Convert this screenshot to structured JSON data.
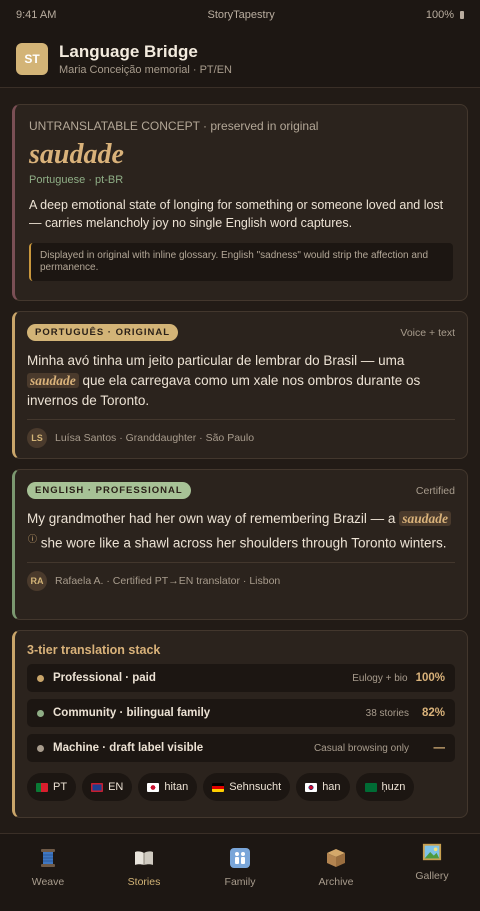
{
  "status": {
    "time": "9:41 AM",
    "app": "StoryTapestry",
    "battery": "100%"
  },
  "header": {
    "avatar": "ST",
    "title": "Language Bridge",
    "subtitle": "Maria Conceição memorial · PT/EN"
  },
  "concept": {
    "kicker": "UNTRANSLATABLE CONCEPT · preserved in original",
    "word": "saudade",
    "language": "Portuguese · pt-BR",
    "description": "A deep emotional state of longing for something or someone loved and lost — carries melancholy joy no single English word captures.",
    "note": "Displayed in original with inline glossary. English \"sadness\" would strip the affection and permanence."
  },
  "original": {
    "pill": "PORTUGUÊS · ORIGINAL",
    "meta": "Voice + text",
    "text_before": "Minha avó tinha um jeito particular de lembrar do Brasil — uma",
    "word": "saudade",
    "text_after": "que ela carregava como um xale nos ombros durante os invernos de Toronto.",
    "initials": "LS",
    "attribution": "Luísa Santos · Granddaughter · São Paulo"
  },
  "english": {
    "pill": "ENGLISH · PROFESSIONAL",
    "meta": "Certified",
    "text_before": "My grandmother had her own way of remembering Brazil — a",
    "word": "saudade",
    "info": "ⓘ",
    "text_after": "she wore like a shawl across her shoulders through Toronto winters.",
    "initials": "RA",
    "attribution": "Rafaela A. · Certified PT→EN translator · Lisbon"
  },
  "stack": {
    "title": "3-tier translation stack",
    "tiers": [
      {
        "name": "Professional · paid",
        "note": "Eulogy + bio",
        "value": "100%",
        "color": "#c9a56a"
      },
      {
        "name": "Community · bilingual family",
        "note": "38 stories",
        "value": "82%",
        "color": "#8fae86"
      },
      {
        "name": "Machine · draft label visible",
        "note": "Casual browsing only",
        "value": "—",
        "color": "#a89c8d"
      }
    ],
    "chips": [
      {
        "label": "PT",
        "icon": "flag-portugal-icon"
      },
      {
        "label": "EN",
        "icon": "flag-uk-icon"
      },
      {
        "label": "hitan",
        "icon": "flag-japan-icon"
      },
      {
        "label": "Sehnsucht",
        "icon": "flag-germany-icon"
      },
      {
        "label": "han",
        "icon": "flag-korea-icon"
      },
      {
        "label": "ḥuzn",
        "icon": "flag-saudi-icon"
      }
    ]
  },
  "tabs": [
    {
      "label": "Weave",
      "icon": "spool-icon"
    },
    {
      "label": "Stories",
      "icon": "book-icon",
      "active": true
    },
    {
      "label": "Family",
      "icon": "family-icon"
    },
    {
      "label": "Archive",
      "icon": "box-icon"
    },
    {
      "label": "Gallery",
      "icon": "picture-icon"
    }
  ]
}
